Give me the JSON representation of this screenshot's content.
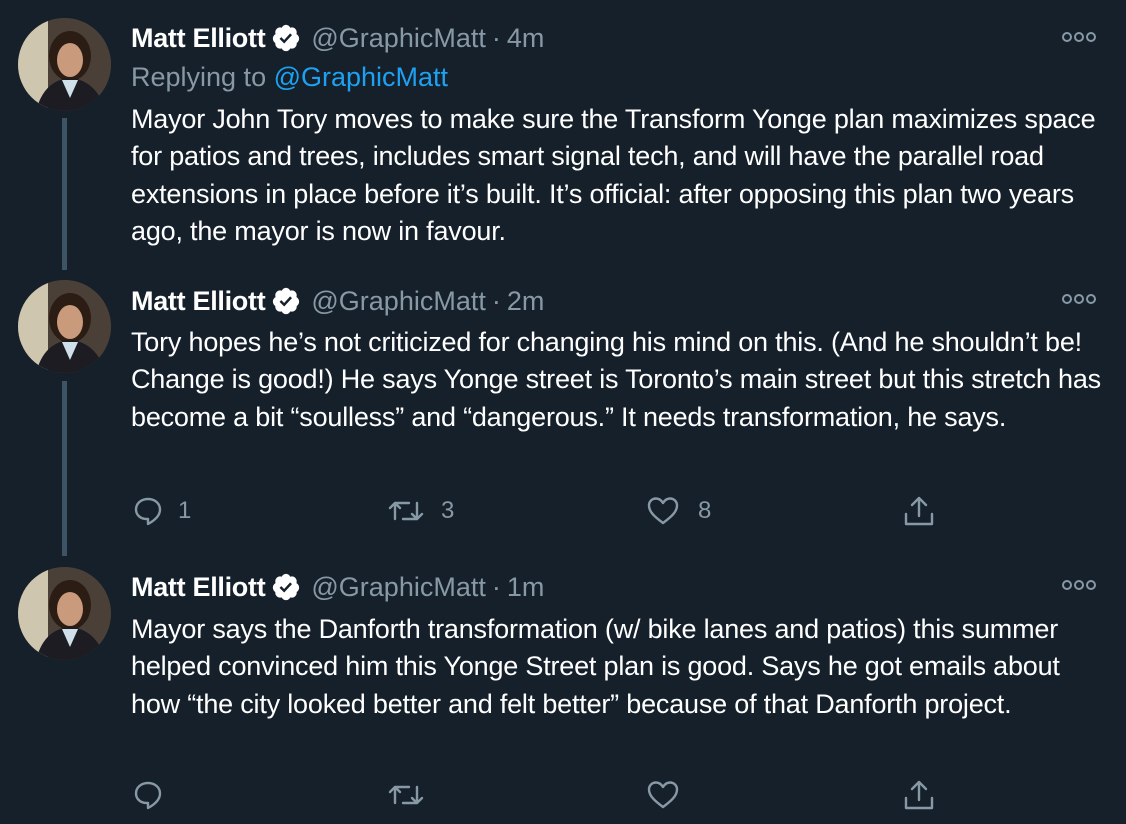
{
  "tweets": [
    {
      "name": "Matt Elliott",
      "handle": "@GraphicMatt",
      "separator": "·",
      "time": "4m",
      "replying_prefix": "Replying to ",
      "replying_handle": "@GraphicMatt",
      "text": "Mayor John Tory moves to make sure the Transform Yonge plan maximizes space for patios and trees, includes smart signal tech, and will have the parallel road extensions in place before it’s built. It’s official: after opposing this plan two years ago, the mayor is now in favour."
    },
    {
      "name": "Matt Elliott",
      "handle": "@GraphicMatt",
      "separator": "·",
      "time": "2m",
      "text": "Tory hopes he’s not criticized for changing his mind on this. (And he shouldn’t be! Change is good!) He says Yonge street is Toronto’s main street but this stretch has become a bit “soulless” and “dangerous.” It needs transformation, he says.",
      "actions": {
        "replies": "1",
        "retweets": "3",
        "likes": "8"
      }
    },
    {
      "name": "Matt Elliott",
      "handle": "@GraphicMatt",
      "separator": "·",
      "time": "1m",
      "text": "Mayor says the Danforth transformation (w/ bike lanes and patios) this summer helped convinced him this Yonge Street plan is good. Says he got emails about how “the city looked better and felt better” because of that Danforth project."
    }
  ],
  "icons": {
    "verified": "verified-badge-icon",
    "more": "more-options-icon",
    "reply": "reply-icon",
    "retweet": "retweet-icon",
    "like": "heart-icon",
    "share": "share-icon"
  },
  "colors": {
    "background": "#15202b",
    "text": "#ffffff",
    "muted": "#8899a6",
    "accent": "#1da1f2",
    "thread_line": "#3d5466"
  }
}
